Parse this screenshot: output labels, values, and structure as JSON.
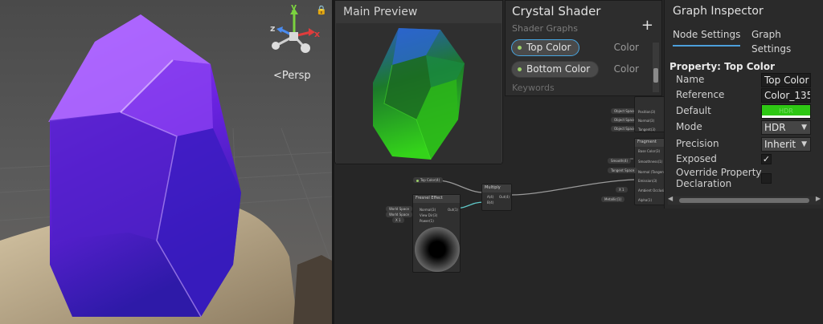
{
  "scene": {
    "view_mode": "Persp",
    "gizmo_axes": {
      "x": "x",
      "y": "y",
      "z": "z"
    },
    "colors": {
      "crystal_top": "#9b3bff",
      "crystal_bottom": "#3618b8",
      "ground": "#c9b89a"
    }
  },
  "main_preview": {
    "title": "Main Preview",
    "colors": {
      "top": "#2a6cc8",
      "bottom": "#2ec714"
    }
  },
  "blackboard": {
    "title": "Crystal Shader",
    "subtitle": "Shader Graphs",
    "add_icon": "plus-icon",
    "properties": [
      {
        "name": "Top Color",
        "type": "Color",
        "selected": true
      },
      {
        "name": "Bottom Color",
        "type": "Color",
        "selected": false
      }
    ],
    "keywords_label": "Keywords"
  },
  "inspector": {
    "title": "Graph Inspector",
    "tabs": [
      "Node Settings",
      "Graph Settings"
    ],
    "active_tab": "Node Settings",
    "section_title": "Property: Top Color",
    "fields": {
      "name_label": "Name",
      "name_value": "Top Color",
      "reference_label": "Reference",
      "reference_value": "Color_135",
      "default_label": "Default",
      "default_color": "#2ec714",
      "default_badge": "HDR",
      "mode_label": "Mode",
      "mode_value": "HDR",
      "precision_label": "Precision",
      "precision_value": "Inherit",
      "exposed_label": "Exposed",
      "exposed_checked": true,
      "override_label_1": "Override Property",
      "override_label_2": "Declaration",
      "override_checked": false
    }
  },
  "graph": {
    "top_color_pill": "Top Color(4)",
    "fresnel": {
      "title": "Fresnel Effect",
      "inputs": [
        "Normal(3)",
        "View Dir(3)",
        "Power(1)"
      ],
      "input_pills": [
        "World Space",
        "World Space",
        "X 1"
      ],
      "output": "Out(1)"
    },
    "multiply": {
      "title": "Multiply",
      "inputs": [
        "A(4)",
        "B(4)"
      ],
      "output": "Out(4)"
    },
    "vertex_ports": [
      "Position(3)",
      "Normal(3)",
      "Tangent(3)"
    ],
    "vertex_pills": [
      "Object Space",
      "Object Space",
      "Object Space"
    ],
    "fragment": {
      "title": "Fragment",
      "ports": [
        "Base Color(3)",
        "Smoothness(1)",
        "Normal (Tangent)",
        "Emission(3)",
        "Ambient Occlusion",
        "Alpha(1)"
      ],
      "pills": [
        "Smooth(4)",
        "Tangent Space",
        "X 1",
        "Metallic(1)"
      ]
    }
  }
}
